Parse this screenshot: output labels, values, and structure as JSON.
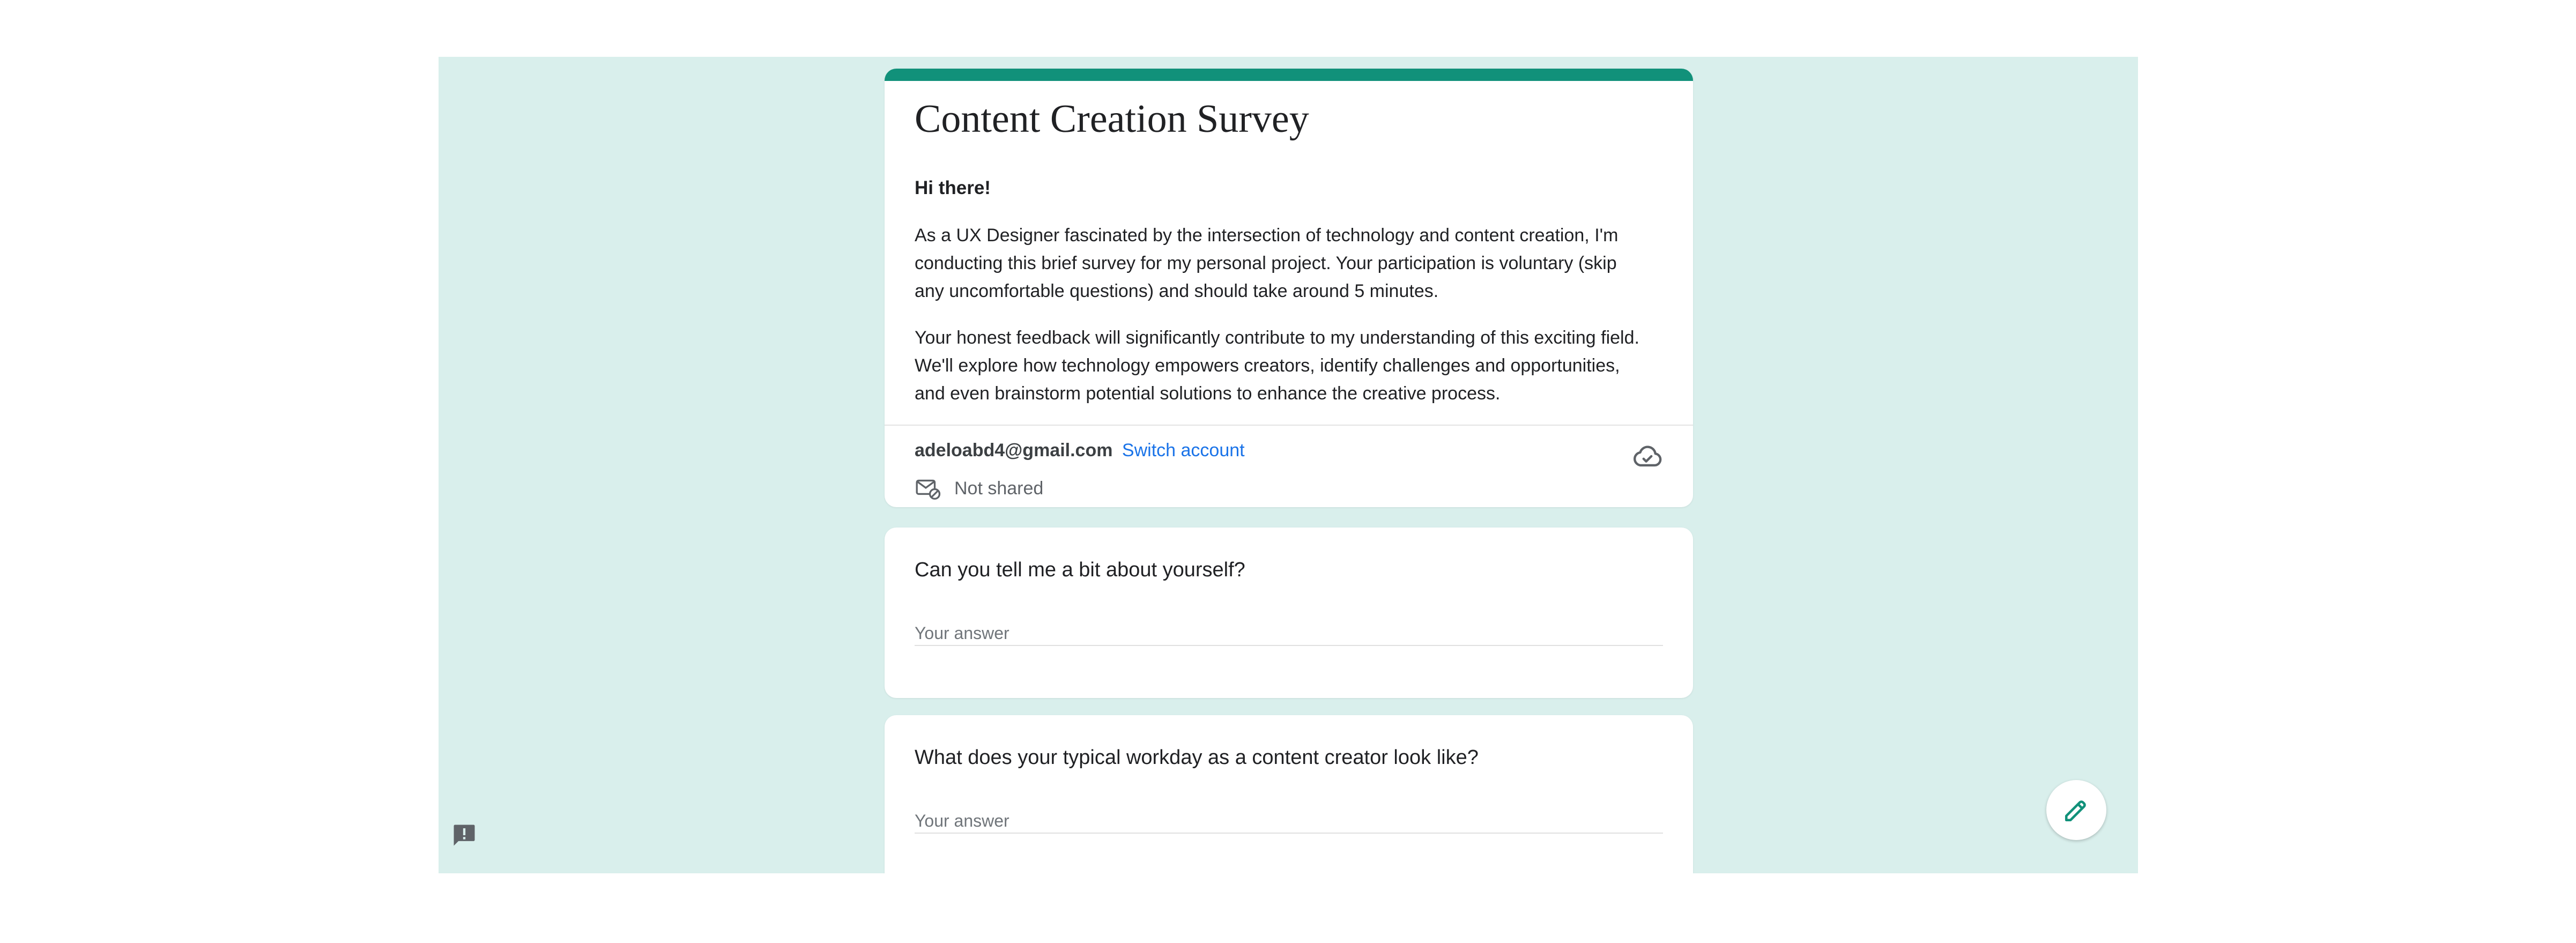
{
  "form": {
    "title": "Content Creation Survey",
    "greeting": "Hi there!",
    "description_1": "As a UX Designer fascinated by the intersection of technology and content creation, I'm conducting this brief survey for my personal project. Your participation is voluntary (skip any uncomfortable questions) and should take around 5 minutes.",
    "description_2": "Your honest feedback will significantly contribute to my understanding of this exciting field. We'll explore how technology empowers creators, identify challenges and opportunities, and even brainstorm potential solutions to enhance the creative process."
  },
  "account": {
    "email": "adeloabd4@gmail.com",
    "switch_label": "Switch account",
    "shared_status": "Not shared"
  },
  "questions": [
    {
      "text": "Can you tell me a bit about yourself?",
      "placeholder": "Your answer"
    },
    {
      "text": "What does your typical workday as a content creator look like?",
      "placeholder": "Your answer"
    }
  ],
  "icons": {
    "cloud": "cloud-sync-icon",
    "mail": "mail-not-shared-icon",
    "feedback": "feedback-icon",
    "edit": "pencil-icon"
  },
  "colors": {
    "background": "#d9efec",
    "accent": "#11917a",
    "link": "#1a73e8"
  }
}
